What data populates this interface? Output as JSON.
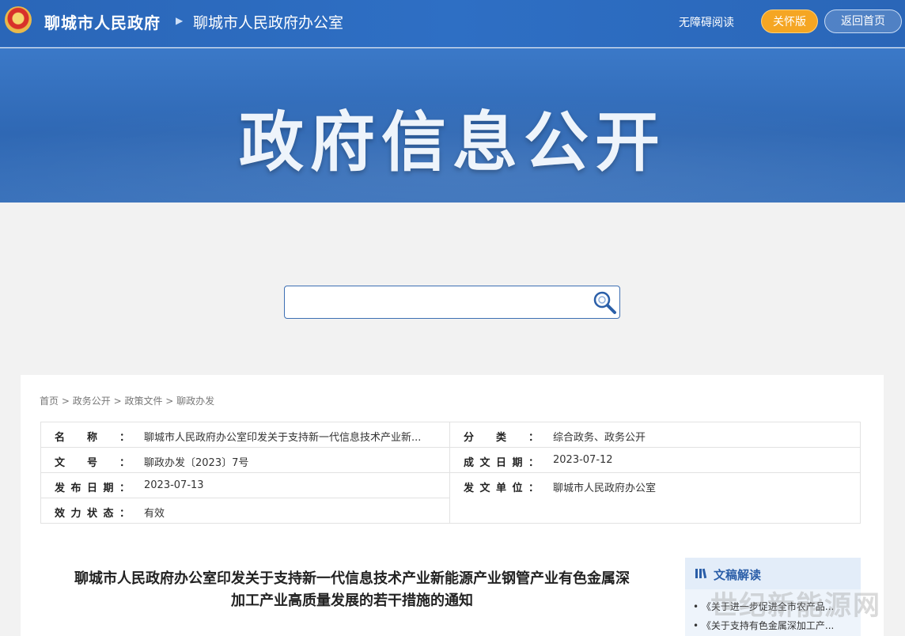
{
  "header": {
    "site_name": "聊城市人民政府",
    "office_name": "聊城市人民政府办公室",
    "accessibility": "无障碍阅读",
    "care_mode": "关怀版",
    "back_home": "返回首页"
  },
  "banner": {
    "title": "政府信息公开"
  },
  "search": {
    "value": "",
    "placeholder": ""
  },
  "breadcrumb": [
    "首页",
    "政务公开",
    "政策文件",
    "聊政办发"
  ],
  "meta": {
    "left": [
      {
        "label": "名称：",
        "value": "聊城市人民政府办公室印发关于支持新一代信息技术产业新..."
      },
      {
        "label": "文号：",
        "value": "聊政办发〔2023〕7号"
      },
      {
        "label": "发布日期：",
        "value": "2023-07-13"
      },
      {
        "label": "效力状态：",
        "value": "有效"
      }
    ],
    "right": [
      {
        "label": "分类：",
        "value": "综合政务、政务公开"
      },
      {
        "label": "成文日期：",
        "value": "2023-07-12"
      },
      {
        "label": "发文单位：",
        "value": "聊城市人民政府办公室"
      }
    ]
  },
  "document": {
    "title_line1": "聊城市人民政府办公室印发关于支持新一代信息技术产业新能源产业钢管产业有色金属深",
    "title_line2": "加工产业高质量发展的若干措施的通知"
  },
  "sidebar": {
    "title": "文稿解读",
    "items": [
      "《关于进一步促进全市农产品...",
      "《关于支持有色金属深加工产..."
    ],
    "watermark": "世纪新能源网"
  }
}
